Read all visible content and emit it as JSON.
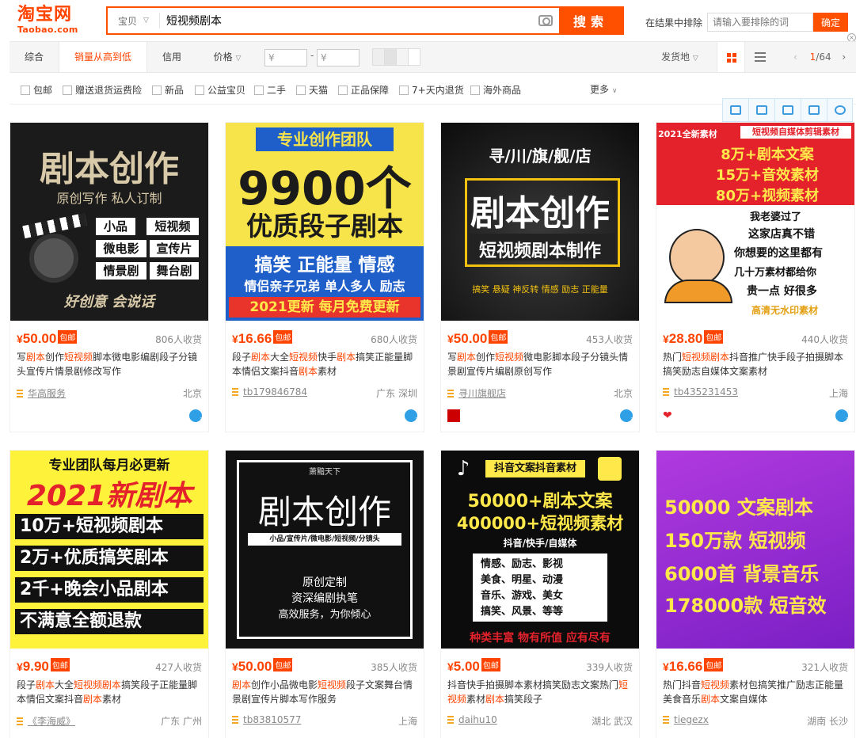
{
  "header": {
    "logo_cn": "淘宝网",
    "logo_en": "Taobao.com",
    "search_scope": "宝贝",
    "search_value": "短视频剧本",
    "search_button": "搜索",
    "exclude_label": "在结果中排除",
    "exclude_placeholder": "请输入要排除的词",
    "exclude_button": "确定"
  },
  "sortbar": {
    "tabs": [
      "综合",
      "销量从高到低",
      "信用",
      "价格"
    ],
    "price_from": "¥",
    "price_to": "¥",
    "dash": "-",
    "ship_from": "发货地",
    "page_current": "1",
    "page_total": "/64"
  },
  "filters": [
    "包邮",
    "赠送退货运费险",
    "新品",
    "公益宝贝",
    "二手",
    "天猫",
    "正品保障",
    "7+天内退货",
    "海外商品"
  ],
  "filters_more": "更多",
  "products": [
    {
      "price": "50.00",
      "badge": "包邮",
      "sales": "806人收货",
      "title_parts": [
        "写",
        "剧本",
        "创作",
        "短视频",
        "脚本微电影编剧段子分镜头宣传片情景剧修改写作"
      ],
      "shop": "华高服务",
      "location": "北京",
      "poster": [
        "剧本创作",
        "原创写作  私人订制",
        "小品",
        "短视频",
        "微电影",
        "宣传片",
        "情景剧",
        "舞台剧",
        "好创意  会说话"
      ]
    },
    {
      "price": "16.66",
      "badge": "包邮",
      "sales": "680人收货",
      "title_parts": [
        "段子",
        "剧本",
        "大全",
        "短视频",
        "快手",
        "剧本",
        "搞笑正能量脚本情侣文案抖音",
        "剧本",
        "素材"
      ],
      "shop": "tb179846784",
      "location": "广东 深圳",
      "poster": [
        "专业创作团队",
        "9900个",
        "优质段子剧本",
        "搞笑  正能量  情感",
        "情侣亲子兄弟 单人多人 励志",
        "2021更新  每月免费更新"
      ]
    },
    {
      "price": "50.00",
      "badge": "包邮",
      "sales": "453人收货",
      "title_parts": [
        "写",
        "剧本",
        "创作",
        "短视频",
        "微电影脚本段子分镜头情景剧宣传片编剧原创写作"
      ],
      "shop": "寻川旗舰店",
      "location": "北京",
      "poster": [
        "寻/川/旗/舰/店",
        "剧本创作",
        "短视频剧本制作",
        "搞笑 悬疑 神反转  情感 励志 正能量"
      ]
    },
    {
      "price": "28.80",
      "badge": "包邮",
      "sales": "440人收货",
      "title_parts": [
        "热门",
        "短视频",
        "剧本",
        "抖音推广快手段子拍摄脚本搞笑励志自媒体文案素材"
      ],
      "shop": "tb435231453",
      "location": "上海",
      "poster": [
        "2021全新素材",
        "短视频自媒体剪辑素材",
        "8万+剧本文案",
        "15万+音效素材",
        "80万+视频素材",
        "我老婆过了",
        "这家店真不错",
        "你想要的这里都有",
        "几十万素材都给你",
        "贵一点  好很多",
        "高清无水印素材"
      ]
    },
    {
      "price": "9.90",
      "badge": "包邮",
      "sales": "427人收货",
      "title_parts": [
        "段子",
        "剧本",
        "大全",
        "短视频剧本",
        "搞笑段子正能量脚本情侣文案抖音",
        "剧本",
        "素材"
      ],
      "shop": "《李海威》",
      "location": "广东 广州",
      "poster": [
        "专业团队每月必更新",
        "2021新剧本",
        "10万+短视频剧本",
        "2万+优质搞笑剧本",
        "2千+晚会小品剧本",
        "不满意全额退款"
      ]
    },
    {
      "price": "50.00",
      "badge": "包邮",
      "sales": "385人收货",
      "title_parts": [
        "",
        "剧本",
        "创作小品微电影",
        "短视频",
        "段子文案舞台情景剧宣传片脚本写作服务"
      ],
      "shop": "tb83810577",
      "location": "上海",
      "poster": [
        "萧黯天下",
        "剧本创作",
        "小品/宣传片/微电影/短视频/分镜头",
        "原创定制",
        "资深编剧执笔",
        "高效服务，为你倾心"
      ]
    },
    {
      "price": "5.00",
      "badge": "包邮",
      "sales": "339人收货",
      "title_parts": [
        "抖音快手拍摄脚本素材搞笑励志文案热门",
        "短视频",
        "素材",
        "剧本",
        "搞笑段子"
      ],
      "shop": "daihu10",
      "location": "湖北 武汉",
      "poster": [
        "抖音文案抖音素材",
        "50000+剧本文案",
        "400000+短视频素材",
        "抖音/快手/自媒体",
        "情感、励志、影视",
        "美食、明星、动漫",
        "音乐、游戏、美女",
        "搞笑、风景、等等",
        "种类丰富 物有所值 应有尽有"
      ]
    },
    {
      "price": "16.66",
      "badge": "包邮",
      "sales": "321人收货",
      "title_parts": [
        "热门抖音",
        "短视频",
        "素材包搞笑推广励志正能量美食音乐",
        "剧本",
        "文案自媒体"
      ],
      "shop": "tiegezx",
      "location": "湖南 长沙",
      "poster": [
        "50000 文案剧本",
        "150万款 短视频",
        "6000首 背景音乐",
        "178000款 短音效"
      ]
    }
  ],
  "colors": {
    "accent": "#ff4400",
    "search_border": "#ff5000"
  }
}
